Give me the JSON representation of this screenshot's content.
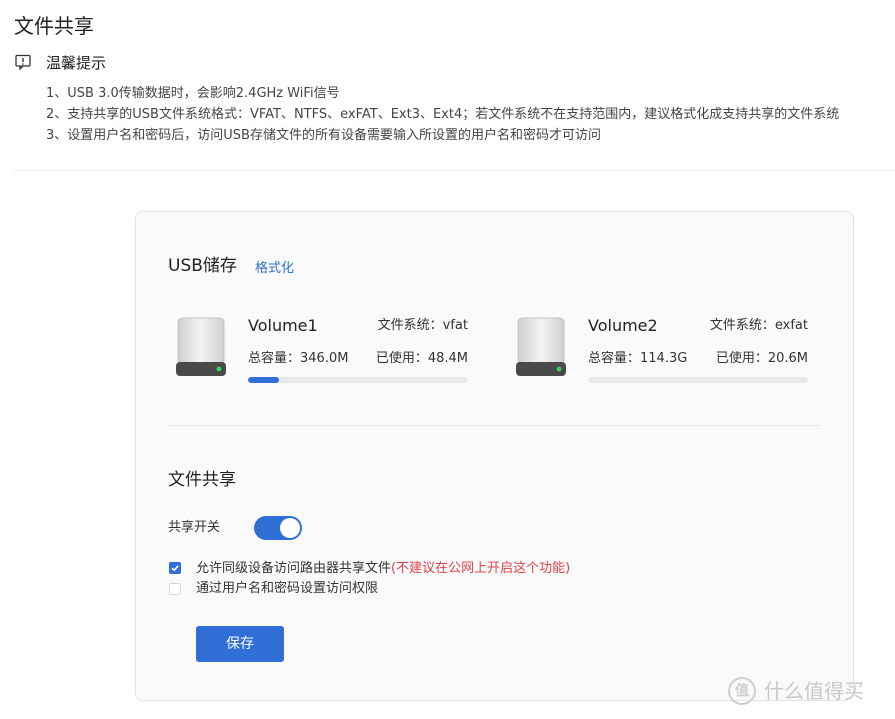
{
  "page": {
    "title": "文件共享"
  },
  "tips": {
    "icon": "info-icon",
    "title": "温馨提示",
    "lines": [
      "1、USB 3.0传输数据时，会影响2.4GHz WiFi信号",
      "2、支持共享的USB文件系统格式：VFAT、NTFS、exFAT、Ext3、Ext4；若文件系统不在支持范围内，建议格式化成支持共享的文件系统",
      "3、设置用户名和密码后，访问USB存储文件的所有设备需要输入所设置的用户名和密码才可访问"
    ]
  },
  "usb": {
    "title": "USB储存",
    "format_link": "格式化",
    "volumes": [
      {
        "icon": "hard-drive-icon",
        "name": "Volume1",
        "fs": "文件系统：vfat",
        "capacity": "总容量：346.0M",
        "used": "已使用：48.4M",
        "usage_fraction": 0.14
      },
      {
        "icon": "hard-drive-icon",
        "name": "Volume2",
        "fs": "文件系统：exfat",
        "capacity": "总容量：114.3G",
        "used": "已使用：20.6M",
        "usage_fraction": 0.0
      }
    ]
  },
  "share": {
    "title": "文件共享",
    "switch_label": "共享开关",
    "switch_on": true,
    "options": [
      {
        "label": "允许同级设备访问路由器共享文件",
        "warning": "(不建议在公网上开启这个功能)",
        "checked": true
      },
      {
        "label": "通过用户名和密码设置访问权限",
        "warning": "",
        "checked": false
      }
    ],
    "save_label": "保存"
  },
  "watermark": {
    "text": "什么值得买",
    "icon_glyph": "值"
  },
  "colors": {
    "accent": "#2f6fd6",
    "warning": "#e0434a"
  }
}
